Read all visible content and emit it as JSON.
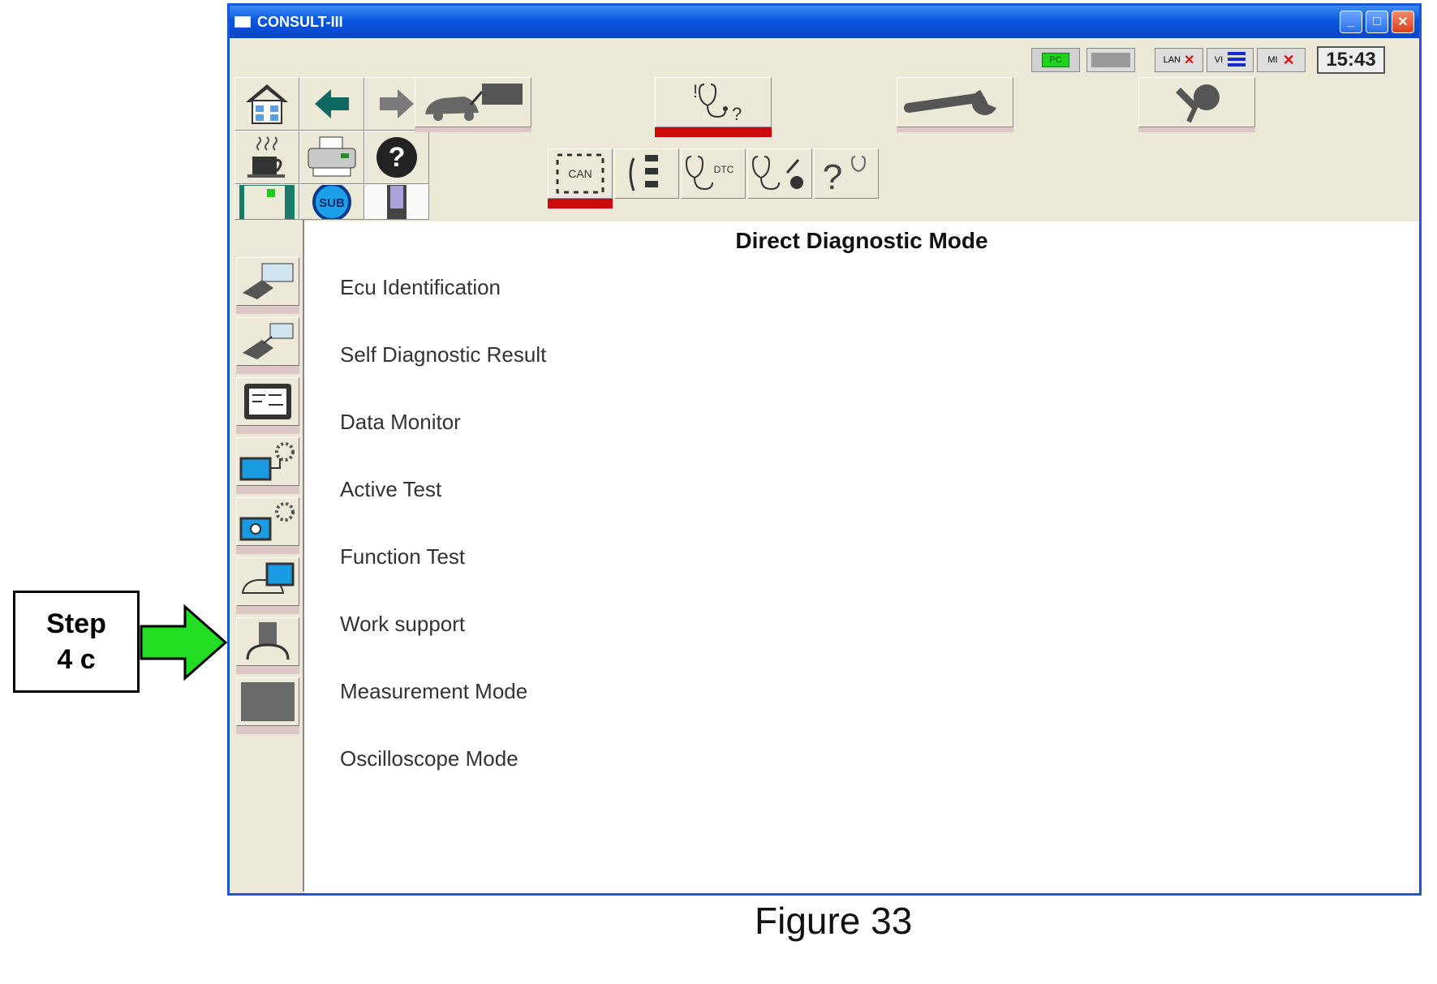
{
  "window": {
    "title": "CONSULT-III",
    "controls": {
      "minimize": "_",
      "maximize": "□",
      "close": "✕"
    }
  },
  "status": {
    "pc_label": "PC",
    "lan_label": "LAN",
    "vi_label": "VI",
    "mi_label": "MI",
    "time": "15:43"
  },
  "toolbar": {
    "sub_label": "SUB",
    "can_label": "CAN",
    "dtc_label": "DTC",
    "help_glyph": "?"
  },
  "content": {
    "title": "Direct Diagnostic Mode",
    "menu_items": [
      "Ecu Identification",
      "Self Diagnostic Result",
      "Data Monitor",
      "Active Test",
      "Function Test",
      "Work support",
      "Measurement Mode",
      "Oscilloscope Mode"
    ]
  },
  "annotation": {
    "step_line1": "Step",
    "step_line2": "4 c",
    "arrow_color": "#22dd22",
    "figure_caption": "Figure 33"
  },
  "colors": {
    "title_bar": "#0a56e0",
    "selected_indicator": "#cc0a0a",
    "window_bg": "#ece9d8"
  }
}
